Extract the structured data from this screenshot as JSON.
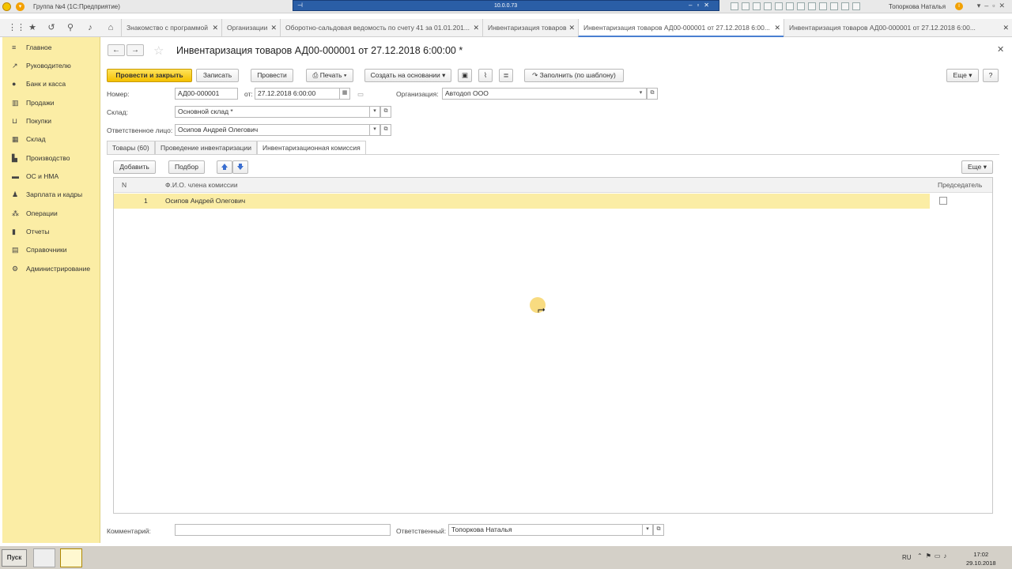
{
  "window": {
    "title": "Группа №4  (1С:Предприятие)",
    "remote_ip": "10.0.0.73",
    "user": "Топоркова Наталья"
  },
  "tabs": [
    {
      "label": "Знакомство с программой"
    },
    {
      "label": "Организации"
    },
    {
      "label": "Оборотно-сальдовая ведомость по счету 41 за 01.01.201..."
    },
    {
      "label": "Инвентаризация товаров"
    },
    {
      "label": "Инвентаризация товаров АД00-000001 от 27.12.2018 6:00..."
    },
    {
      "label": "Инвентаризация товаров АД00-000001 от 27.12.2018 6:00..."
    }
  ],
  "sidebar": {
    "items": [
      {
        "label": "Главное",
        "icon": "menu-icon"
      },
      {
        "label": "Руководителю",
        "icon": "trend-icon"
      },
      {
        "label": "Банк и касса",
        "icon": "money-icon"
      },
      {
        "label": "Продажи",
        "icon": "sales-icon"
      },
      {
        "label": "Покупки",
        "icon": "cart-icon"
      },
      {
        "label": "Склад",
        "icon": "warehouse-icon"
      },
      {
        "label": "Производство",
        "icon": "factory-icon"
      },
      {
        "label": "ОС и НМА",
        "icon": "truck-icon"
      },
      {
        "label": "Зарплата и кадры",
        "icon": "person-icon"
      },
      {
        "label": "Операции",
        "icon": "operations-icon"
      },
      {
        "label": "Отчеты",
        "icon": "chart-icon"
      },
      {
        "label": "Справочники",
        "icon": "book-icon"
      },
      {
        "label": "Администрирование",
        "icon": "gear-icon"
      }
    ]
  },
  "document": {
    "title": "Инвентаризация товаров АД00-000001 от 27.12.2018 6:00:00 *",
    "buttons": {
      "post_close": "Провести и закрыть",
      "save": "Записать",
      "post": "Провести",
      "print": "Печать",
      "create_based": "Создать на основании",
      "fill_template": "Заполнить (по шаблону)",
      "more": "Еще",
      "help": "?"
    },
    "fields": {
      "number_label": "Номер:",
      "number": "АД00-000001",
      "date_label": "от:",
      "date": "27.12.2018  6:00:00",
      "org_label": "Организация:",
      "org": "Автодоп ООО",
      "warehouse_label": "Склад:",
      "warehouse": "Основной склад *",
      "resp_label": "Ответственное лицо:",
      "resp": "Осипов Андрей Олегович"
    },
    "form_tabs": [
      {
        "label": "Товары (60)"
      },
      {
        "label": "Проведение инвентаризации"
      },
      {
        "label": "Инвентаризационная комиссия"
      }
    ],
    "table_toolbar": {
      "add": "Добавить",
      "pick": "Подбор",
      "more": "Еще"
    },
    "table": {
      "columns": [
        "N",
        "Ф.И.О. члена комиссии",
        "Председатель"
      ],
      "rows": [
        {
          "n": "1",
          "name": "Осипов Андрей Олегович",
          "chairman": false
        }
      ]
    },
    "footer": {
      "comment_label": "Комментарий:",
      "comment": "",
      "responsible_label": "Ответственный:",
      "responsible": "Топоркова Наталья"
    }
  },
  "taskbar": {
    "start": "Пуск",
    "lang": "RU",
    "time": "17:02",
    "date": "29.10.2018"
  }
}
